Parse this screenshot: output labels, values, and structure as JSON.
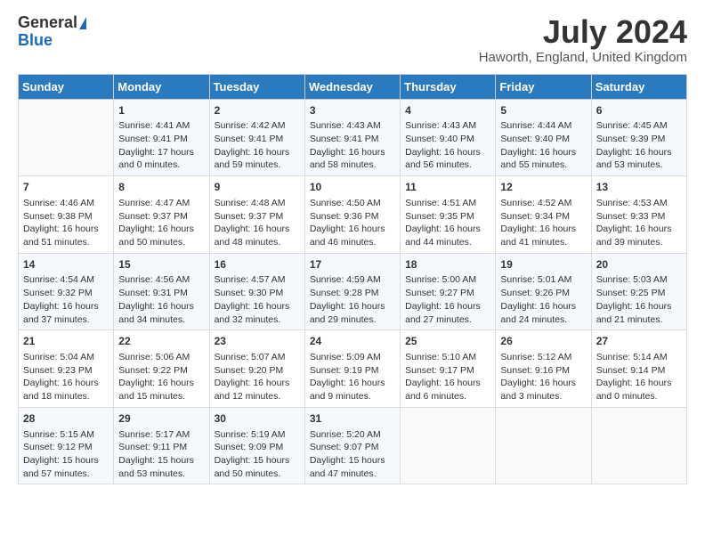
{
  "header": {
    "logo_general": "General",
    "logo_blue": "Blue",
    "month_title": "July 2024",
    "location": "Haworth, England, United Kingdom"
  },
  "days_of_week": [
    "Sunday",
    "Monday",
    "Tuesday",
    "Wednesday",
    "Thursday",
    "Friday",
    "Saturday"
  ],
  "weeks": [
    [
      {
        "day": "",
        "info": ""
      },
      {
        "day": "1",
        "info": "Sunrise: 4:41 AM\nSunset: 9:41 PM\nDaylight: 17 hours\nand 0 minutes."
      },
      {
        "day": "2",
        "info": "Sunrise: 4:42 AM\nSunset: 9:41 PM\nDaylight: 16 hours\nand 59 minutes."
      },
      {
        "day": "3",
        "info": "Sunrise: 4:43 AM\nSunset: 9:41 PM\nDaylight: 16 hours\nand 58 minutes."
      },
      {
        "day": "4",
        "info": "Sunrise: 4:43 AM\nSunset: 9:40 PM\nDaylight: 16 hours\nand 56 minutes."
      },
      {
        "day": "5",
        "info": "Sunrise: 4:44 AM\nSunset: 9:40 PM\nDaylight: 16 hours\nand 55 minutes."
      },
      {
        "day": "6",
        "info": "Sunrise: 4:45 AM\nSunset: 9:39 PM\nDaylight: 16 hours\nand 53 minutes."
      }
    ],
    [
      {
        "day": "7",
        "info": "Sunrise: 4:46 AM\nSunset: 9:38 PM\nDaylight: 16 hours\nand 51 minutes."
      },
      {
        "day": "8",
        "info": "Sunrise: 4:47 AM\nSunset: 9:37 PM\nDaylight: 16 hours\nand 50 minutes."
      },
      {
        "day": "9",
        "info": "Sunrise: 4:48 AM\nSunset: 9:37 PM\nDaylight: 16 hours\nand 48 minutes."
      },
      {
        "day": "10",
        "info": "Sunrise: 4:50 AM\nSunset: 9:36 PM\nDaylight: 16 hours\nand 46 minutes."
      },
      {
        "day": "11",
        "info": "Sunrise: 4:51 AM\nSunset: 9:35 PM\nDaylight: 16 hours\nand 44 minutes."
      },
      {
        "day": "12",
        "info": "Sunrise: 4:52 AM\nSunset: 9:34 PM\nDaylight: 16 hours\nand 41 minutes."
      },
      {
        "day": "13",
        "info": "Sunrise: 4:53 AM\nSunset: 9:33 PM\nDaylight: 16 hours\nand 39 minutes."
      }
    ],
    [
      {
        "day": "14",
        "info": "Sunrise: 4:54 AM\nSunset: 9:32 PM\nDaylight: 16 hours\nand 37 minutes."
      },
      {
        "day": "15",
        "info": "Sunrise: 4:56 AM\nSunset: 9:31 PM\nDaylight: 16 hours\nand 34 minutes."
      },
      {
        "day": "16",
        "info": "Sunrise: 4:57 AM\nSunset: 9:30 PM\nDaylight: 16 hours\nand 32 minutes."
      },
      {
        "day": "17",
        "info": "Sunrise: 4:59 AM\nSunset: 9:28 PM\nDaylight: 16 hours\nand 29 minutes."
      },
      {
        "day": "18",
        "info": "Sunrise: 5:00 AM\nSunset: 9:27 PM\nDaylight: 16 hours\nand 27 minutes."
      },
      {
        "day": "19",
        "info": "Sunrise: 5:01 AM\nSunset: 9:26 PM\nDaylight: 16 hours\nand 24 minutes."
      },
      {
        "day": "20",
        "info": "Sunrise: 5:03 AM\nSunset: 9:25 PM\nDaylight: 16 hours\nand 21 minutes."
      }
    ],
    [
      {
        "day": "21",
        "info": "Sunrise: 5:04 AM\nSunset: 9:23 PM\nDaylight: 16 hours\nand 18 minutes."
      },
      {
        "day": "22",
        "info": "Sunrise: 5:06 AM\nSunset: 9:22 PM\nDaylight: 16 hours\nand 15 minutes."
      },
      {
        "day": "23",
        "info": "Sunrise: 5:07 AM\nSunset: 9:20 PM\nDaylight: 16 hours\nand 12 minutes."
      },
      {
        "day": "24",
        "info": "Sunrise: 5:09 AM\nSunset: 9:19 PM\nDaylight: 16 hours\nand 9 minutes."
      },
      {
        "day": "25",
        "info": "Sunrise: 5:10 AM\nSunset: 9:17 PM\nDaylight: 16 hours\nand 6 minutes."
      },
      {
        "day": "26",
        "info": "Sunrise: 5:12 AM\nSunset: 9:16 PM\nDaylight: 16 hours\nand 3 minutes."
      },
      {
        "day": "27",
        "info": "Sunrise: 5:14 AM\nSunset: 9:14 PM\nDaylight: 16 hours\nand 0 minutes."
      }
    ],
    [
      {
        "day": "28",
        "info": "Sunrise: 5:15 AM\nSunset: 9:12 PM\nDaylight: 15 hours\nand 57 minutes."
      },
      {
        "day": "29",
        "info": "Sunrise: 5:17 AM\nSunset: 9:11 PM\nDaylight: 15 hours\nand 53 minutes."
      },
      {
        "day": "30",
        "info": "Sunrise: 5:19 AM\nSunset: 9:09 PM\nDaylight: 15 hours\nand 50 minutes."
      },
      {
        "day": "31",
        "info": "Sunrise: 5:20 AM\nSunset: 9:07 PM\nDaylight: 15 hours\nand 47 minutes."
      },
      {
        "day": "",
        "info": ""
      },
      {
        "day": "",
        "info": ""
      },
      {
        "day": "",
        "info": ""
      }
    ]
  ]
}
